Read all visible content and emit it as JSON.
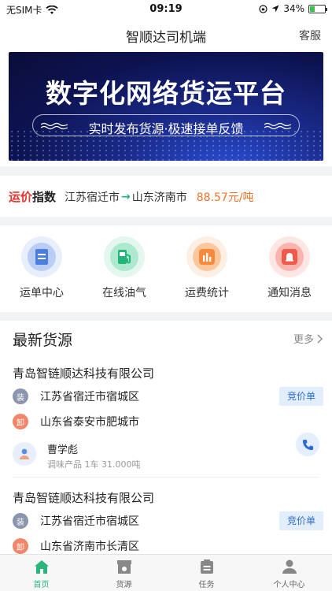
{
  "status_bar": {
    "carrier": "无SIM卡",
    "time": "09:19",
    "battery": "34%",
    "battery_level": 0.34
  },
  "nav": {
    "title": "智顺达司机端",
    "right_action": "客服"
  },
  "banner": {
    "title": "数字化网络货运平台",
    "subtitle": "实时发布货源·极速接单反馈"
  },
  "freight_index": {
    "label_red": "运价",
    "label_black": "指数",
    "origin": "江苏宿迁市",
    "destination": "山东济南市",
    "price": "88.57元/吨"
  },
  "quick_actions": [
    {
      "label": "运单中心",
      "icon": "waybill-icon"
    },
    {
      "label": "在线油气",
      "icon": "fuel-pump-icon"
    },
    {
      "label": "运费统计",
      "icon": "bar-chart-icon"
    },
    {
      "label": "通知消息",
      "icon": "bell-icon"
    }
  ],
  "latest": {
    "title": "最新货源",
    "more": "更多",
    "cards": [
      {
        "company": "青岛智链顺达科技有限公司",
        "load_tag": "装",
        "load_place": "江苏省宿迁市宿城区",
        "unload_tag": "卸",
        "unload_place": "山东省泰安市肥城市",
        "bid_label": "竞价单",
        "driver": "曹学彪",
        "cargo": "调味产品 1车 31.000吨"
      },
      {
        "company": "青岛智链顺达科技有限公司",
        "load_tag": "装",
        "load_place": "江苏省宿迁市宿城区",
        "unload_tag": "卸",
        "unload_place": "山东省济南市长清区",
        "bid_label": "竞价单"
      }
    ]
  },
  "tabbar": [
    {
      "label": "首页",
      "icon": "home-icon",
      "active": true
    },
    {
      "label": "货源",
      "icon": "cargo-box-icon",
      "active": false
    },
    {
      "label": "任务",
      "icon": "task-clipboard-icon",
      "active": false
    },
    {
      "label": "个人中心",
      "icon": "user-icon",
      "active": false
    }
  ],
  "colors": {
    "accent_green": "#2bb57a",
    "price_orange": "#f2732b",
    "index_red": "#e5322d",
    "bid_blue": "#2f6ccf"
  }
}
